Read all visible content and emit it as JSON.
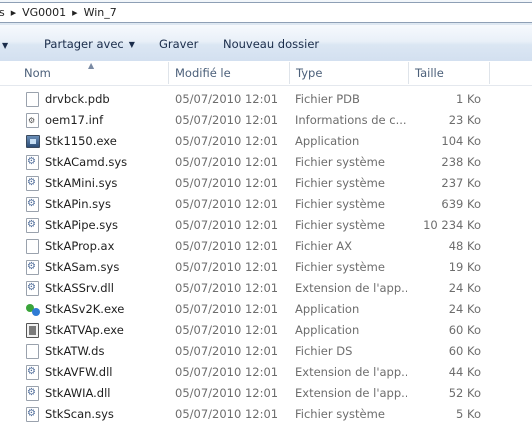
{
  "breadcrumb": {
    "items": [
      "s",
      "VG0001",
      "Win_7"
    ]
  },
  "toolbar": {
    "share_label": "Partager avec",
    "burn_label": "Graver",
    "new_folder_label": "Nouveau dossier"
  },
  "columns": {
    "name": "Nom",
    "modified": "Modifié le",
    "type": "Type",
    "size": "Taille"
  },
  "files": [
    {
      "name": "drvbck.pdb",
      "modified": "05/07/2010 12:01",
      "type": "Fichier PDB",
      "size": "1 Ko",
      "icon": "blank-file-icon"
    },
    {
      "name": "oem17.inf",
      "modified": "05/07/2010 12:01",
      "type": "Informations de c...",
      "size": "23 Ko",
      "icon": "inf-file-icon"
    },
    {
      "name": "Stk1150.exe",
      "modified": "05/07/2010 12:01",
      "type": "Application",
      "size": "104 Ko",
      "icon": "application-icon"
    },
    {
      "name": "StkACamd.sys",
      "modified": "05/07/2010 12:01",
      "type": "Fichier système",
      "size": "238 Ko",
      "icon": "system-file-icon"
    },
    {
      "name": "StkAMini.sys",
      "modified": "05/07/2010 12:01",
      "type": "Fichier système",
      "size": "237 Ko",
      "icon": "system-file-icon"
    },
    {
      "name": "StkAPin.sys",
      "modified": "05/07/2010 12:01",
      "type": "Fichier système",
      "size": "639 Ko",
      "icon": "system-file-icon"
    },
    {
      "name": "StkAPipe.sys",
      "modified": "05/07/2010 12:01",
      "type": "Fichier système",
      "size": "10 234 Ko",
      "icon": "system-file-icon",
      "hovered": true
    },
    {
      "name": "StkAProp.ax",
      "modified": "05/07/2010 12:01",
      "type": "Fichier AX",
      "size": "48 Ko",
      "icon": "blank-file-icon"
    },
    {
      "name": "StkASam.sys",
      "modified": "05/07/2010 12:01",
      "type": "Fichier système",
      "size": "19 Ko",
      "icon": "system-file-icon"
    },
    {
      "name": "StkASSrv.dll",
      "modified": "05/07/2010 12:01",
      "type": "Extension de l'app...",
      "size": "24 Ko",
      "icon": "system-file-icon"
    },
    {
      "name": "StkASv2K.exe",
      "modified": "05/07/2010 12:01",
      "type": "Application",
      "size": "24 Ko",
      "icon": "application-icon-2"
    },
    {
      "name": "StkATVAp.exe",
      "modified": "05/07/2010 12:01",
      "type": "Application",
      "size": "60 Ko",
      "icon": "application-icon-3"
    },
    {
      "name": "StkATW.ds",
      "modified": "05/07/2010 12:01",
      "type": "Fichier DS",
      "size": "60 Ko",
      "icon": "blank-file-icon"
    },
    {
      "name": "StkAVFW.dll",
      "modified": "05/07/2010 12:01",
      "type": "Extension de l'app...",
      "size": "44 Ko",
      "icon": "system-file-icon"
    },
    {
      "name": "StkAWIA.dll",
      "modified": "05/07/2010 12:01",
      "type": "Extension de l'app...",
      "size": "52 Ko",
      "icon": "system-file-icon"
    },
    {
      "name": "StkScan.sys",
      "modified": "05/07/2010 12:01",
      "type": "Fichier système",
      "size": "5 Ko",
      "icon": "system-file-icon"
    }
  ]
}
